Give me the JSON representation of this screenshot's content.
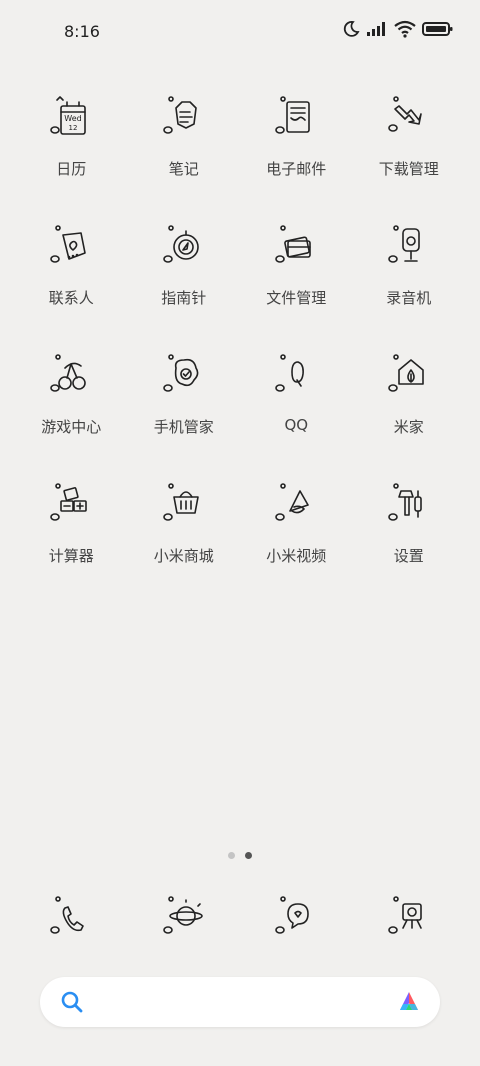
{
  "status_bar": {
    "time": "8:16"
  },
  "apps": [
    {
      "label": "日历",
      "icon": "calendar-icon",
      "day": "Wed",
      "date": "12"
    },
    {
      "label": "笔记",
      "icon": "notes-icon"
    },
    {
      "label": "电子邮件",
      "icon": "email-icon"
    },
    {
      "label": "下载管理",
      "icon": "download-icon"
    },
    {
      "label": "联系人",
      "icon": "contacts-icon"
    },
    {
      "label": "指南针",
      "icon": "compass-icon"
    },
    {
      "label": "文件管理",
      "icon": "files-icon"
    },
    {
      "label": "录音机",
      "icon": "recorder-icon"
    },
    {
      "label": "游戏中心",
      "icon": "game-center-icon"
    },
    {
      "label": "手机管家",
      "icon": "security-icon"
    },
    {
      "label": "QQ",
      "icon": "qq-icon"
    },
    {
      "label": "米家",
      "icon": "mijia-icon"
    },
    {
      "label": "计算器",
      "icon": "calculator-icon"
    },
    {
      "label": "小米商城",
      "icon": "mi-store-icon"
    },
    {
      "label": "小米视频",
      "icon": "mi-video-icon"
    },
    {
      "label": "设置",
      "icon": "settings-icon"
    }
  ],
  "page_indicator": {
    "pages": 2,
    "current": 2
  },
  "dock": [
    {
      "icon": "phone-icon"
    },
    {
      "icon": "browser-icon"
    },
    {
      "icon": "messages-icon"
    },
    {
      "icon": "camera-icon"
    }
  ],
  "search": {
    "placeholder": ""
  },
  "colors": {
    "background": "#f1f0ee",
    "search_icon": "#2a8ef2",
    "line": "#222222"
  }
}
